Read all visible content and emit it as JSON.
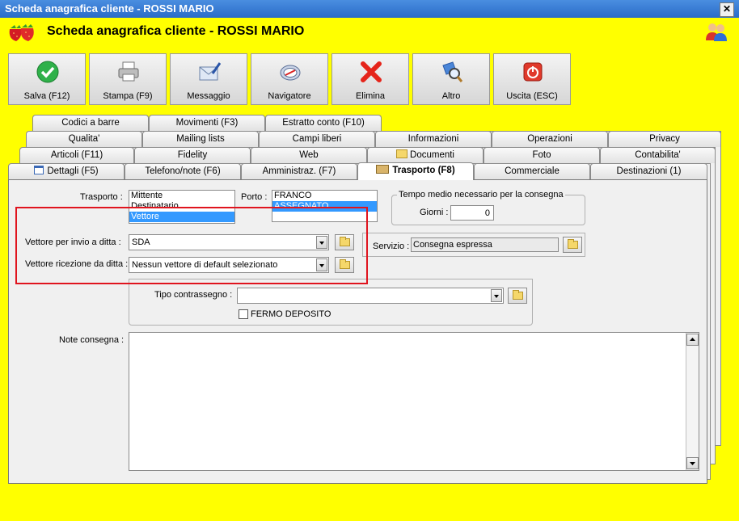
{
  "window": {
    "title": "Scheda anagrafica cliente - ROSSI MARIO",
    "close_glyph": "✕"
  },
  "header": {
    "title": "Scheda anagrafica cliente - ROSSI MARIO"
  },
  "toolbar": {
    "save": "Salva (F12)",
    "print": "Stampa (F9)",
    "message": "Messaggio",
    "navigator": "Navigatore",
    "delete": "Elimina",
    "other": "Altro",
    "exit": "Uscita (ESC)"
  },
  "tabs": {
    "row5": [
      "Codici a barre",
      "Movimenti (F3)",
      "Estratto conto (F10)"
    ],
    "row4": [
      "Qualita'",
      "Mailing lists",
      "Campi liberi",
      "Informazioni",
      "Operazioni",
      "Privacy"
    ],
    "row3": [
      "Articoli (F11)",
      "Fidelity",
      "Web",
      "Documenti",
      "Foto",
      "Contabilita'"
    ],
    "row2": [
      "Dettagli (F5)",
      "Telefono/note (F6)",
      "Amministraz. (F7)",
      "Trasporto (F8)",
      "Commerciale",
      "Destinazioni (1)"
    ]
  },
  "form": {
    "trasporto_label": "Trasporto :",
    "trasporto_options": [
      "Mittente",
      "Destinatario",
      "Vettore"
    ],
    "porto_label": "Porto :",
    "porto_options": [
      "FRANCO",
      "ASSEGNATO"
    ],
    "tempo_group": "Tempo medio necessario per la consegna",
    "giorni_label": "Giorni :",
    "giorni_value": "0",
    "vettore_invio_label": "Vettore per invio a ditta :",
    "vettore_invio_value": "SDA",
    "vettore_ricezione_label": "Vettore ricezione da ditta :",
    "vettore_ricezione_value": "Nessun vettore di default selezionato",
    "servizio_label": "Servizio :",
    "servizio_value": "Consegna espressa",
    "contrassegno_label": "Tipo contrassegno :",
    "contrassegno_value": "",
    "fermo_label": "FERMO DEPOSITO",
    "note_label": "Note consegna :",
    "note_value": ""
  },
  "colors": {
    "background": "#ffff00",
    "selection": "#3399ff",
    "highlight": "#e0141e"
  }
}
